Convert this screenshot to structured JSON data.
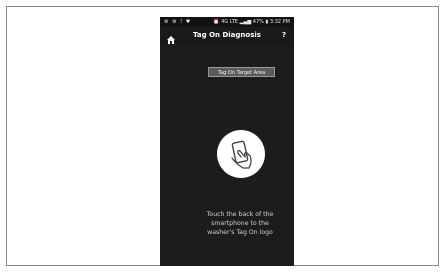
{
  "status_bar": {
    "left_icons": "⚙ ⚙ ! ♥",
    "right": "⏰ 4G LTE ▂▄▆ 47% ▮ 3:32 PM"
  },
  "app_bar": {
    "title": "Tag On Diagnosis",
    "help": "?"
  },
  "main": {
    "target_button": "Tag On Target Area",
    "instruction_lines": [
      "Touch the back of the",
      "smartphone to the",
      "washer's Tag On logo"
    ]
  },
  "icons": {
    "home": "home-icon",
    "tap": "phone-tap-icon"
  },
  "colors": {
    "screen_bg": "#1c1c1c",
    "circle": "#ffffff",
    "button_bg": "#5b5b5b"
  }
}
